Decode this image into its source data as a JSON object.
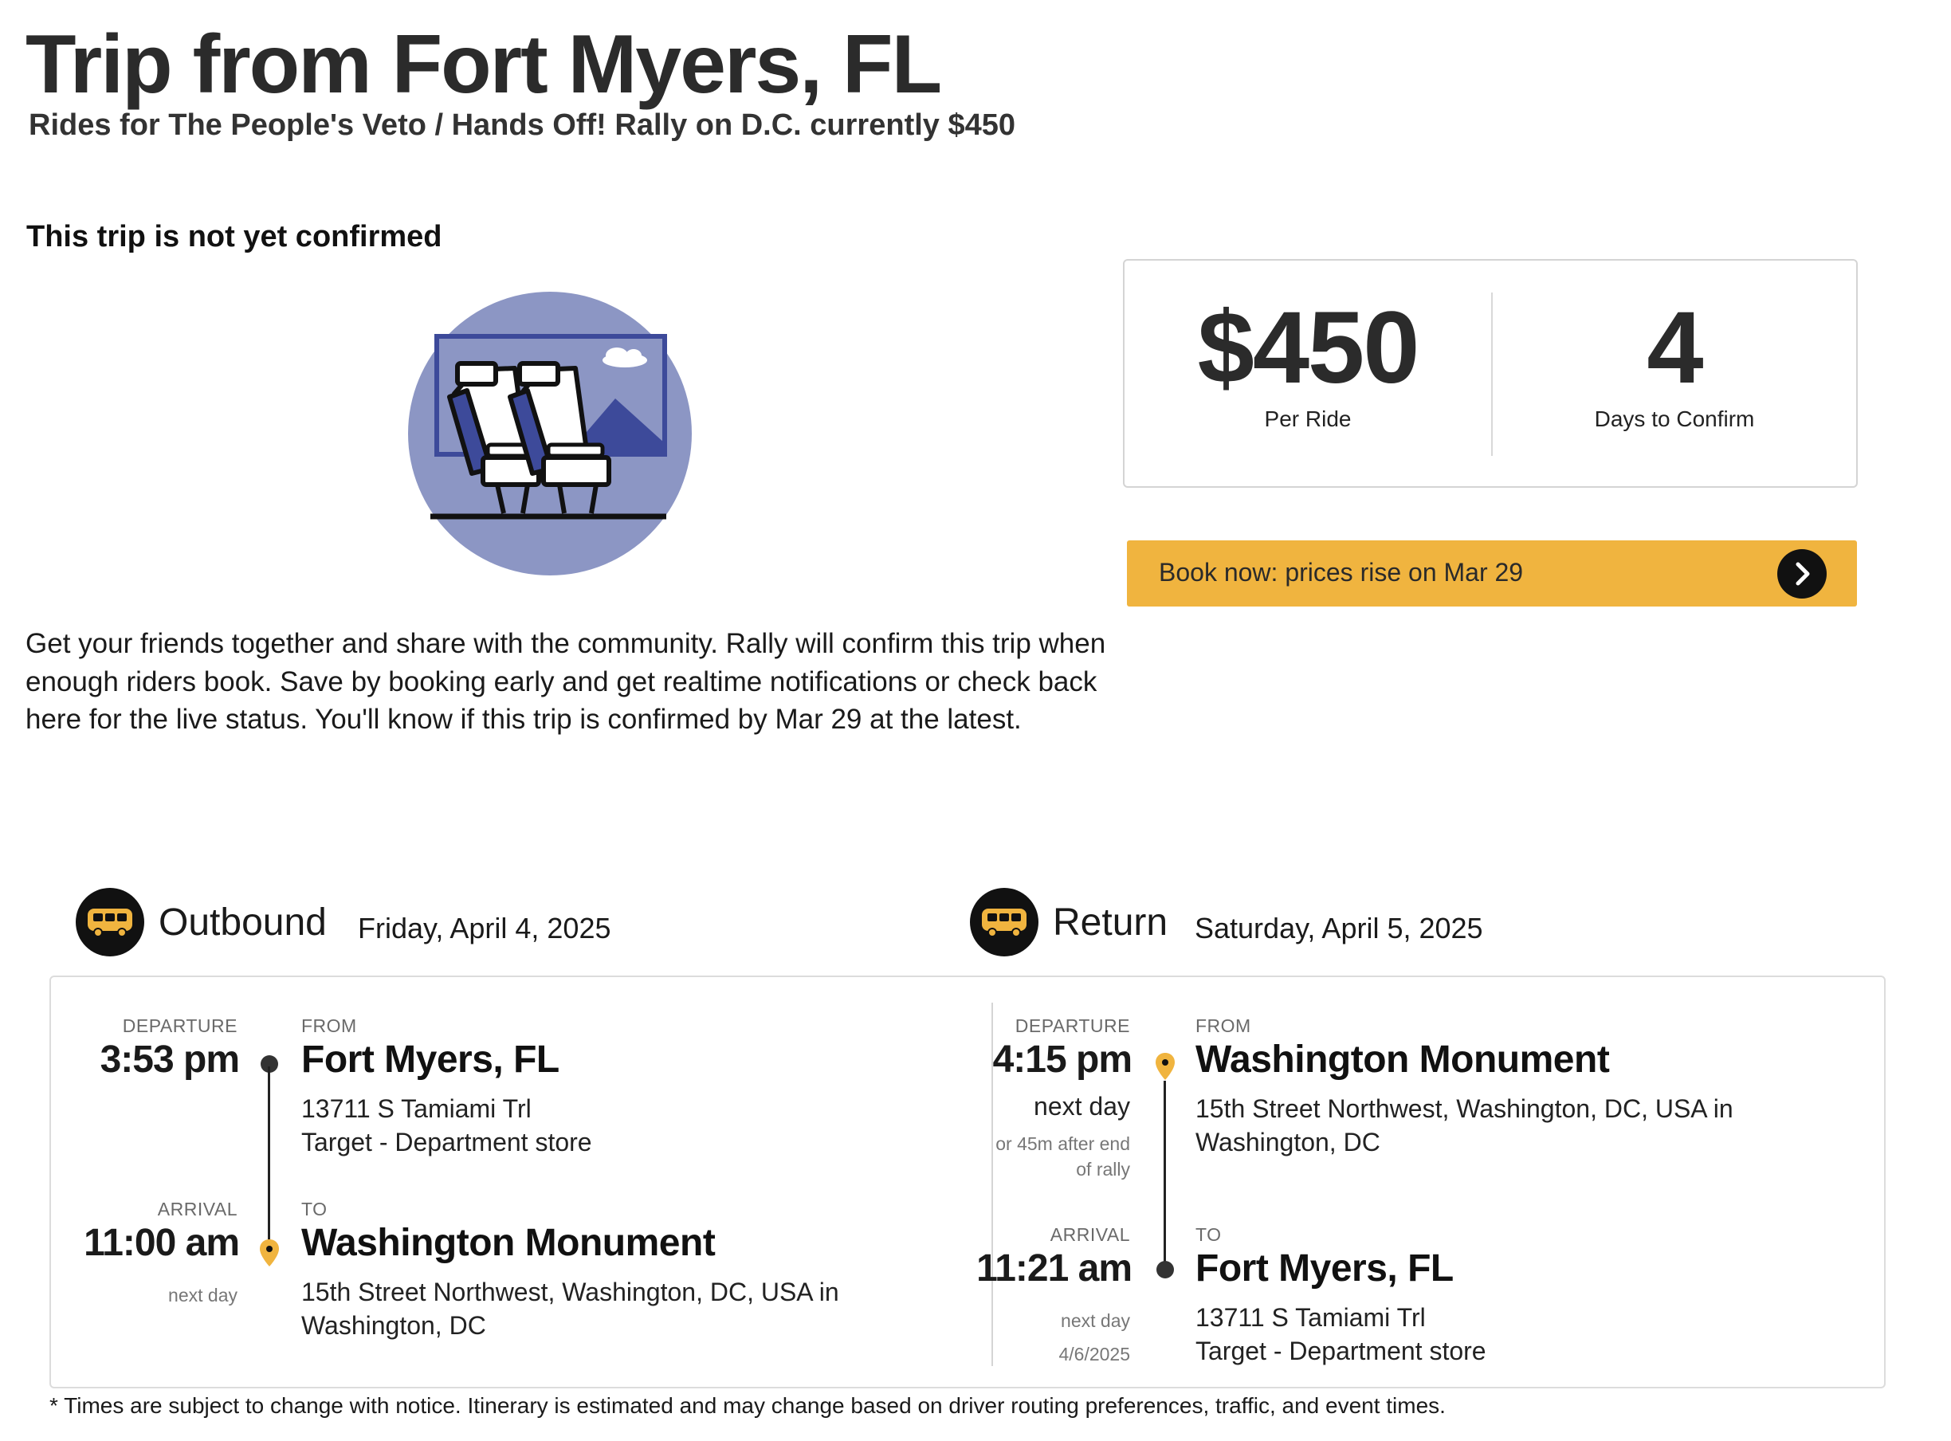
{
  "header": {
    "title": "Trip from Fort Myers, FL",
    "subtitle": "Rides for The People's Veto / Hands Off! Rally on D.C. currently $450"
  },
  "status": {
    "heading": "This trip is not yet confirmed",
    "description": "Get your friends together and share with the community. Rally will confirm this trip when enough riders book. Save by booking early and get realtime notifications or check back here for the live status. You'll know if this trip is confirmed by Mar 29 at the latest.",
    "illustration_icon": "bus-seats-illustration"
  },
  "stats": {
    "price": "$450",
    "price_label": "Per Ride",
    "days": "4",
    "days_label": "Days to Confirm"
  },
  "cta": {
    "label": "Book now: prices rise on Mar 29",
    "icon": "chevron-right-icon"
  },
  "outbound": {
    "title": "Outbound",
    "date": "Friday, April 4, 2025",
    "departure_label": "DEPARTURE",
    "departure_time": "3:53 pm",
    "from_label": "FROM",
    "from_place": "Fort Myers, FL",
    "from_address_1": "13711 S Tamiami Trl",
    "from_address_2": "Target - Department store",
    "arrival_label": "ARRIVAL",
    "arrival_time": "11:00 am",
    "arrival_note": "next day",
    "to_label": "TO",
    "to_place": "Washington Monument",
    "to_address_1": "15th Street Northwest, Washington, DC, USA in",
    "to_address_2": "Washington, DC"
  },
  "return": {
    "title": "Return",
    "date": "Saturday, April 5, 2025",
    "departure_label": "DEPARTURE",
    "departure_time": "4:15 pm",
    "departure_note": "next day",
    "departure_detail_1": "or 45m after end",
    "departure_detail_2": "of rally",
    "from_label": "FROM",
    "from_place": "Washington Monument",
    "from_address_1": "15th Street Northwest, Washington, DC, USA in",
    "from_address_2": "Washington, DC",
    "arrival_label": "ARRIVAL",
    "arrival_time": "11:21 am",
    "arrival_note": "next day",
    "arrival_date": "4/6/2025",
    "to_label": "TO",
    "to_place": "Fort Myers, FL",
    "to_address_1": "13711 S Tamiami Trl",
    "to_address_2": "Target - Department store"
  },
  "footnote": "* Times are subject to change with notice. Itinerary is estimated and may change based on driver routing preferences, traffic, and event times.",
  "colors": {
    "accent": "#f0b43f",
    "illustration_bg": "#8c96c4",
    "illustration_dark": "#3d4a9a"
  }
}
